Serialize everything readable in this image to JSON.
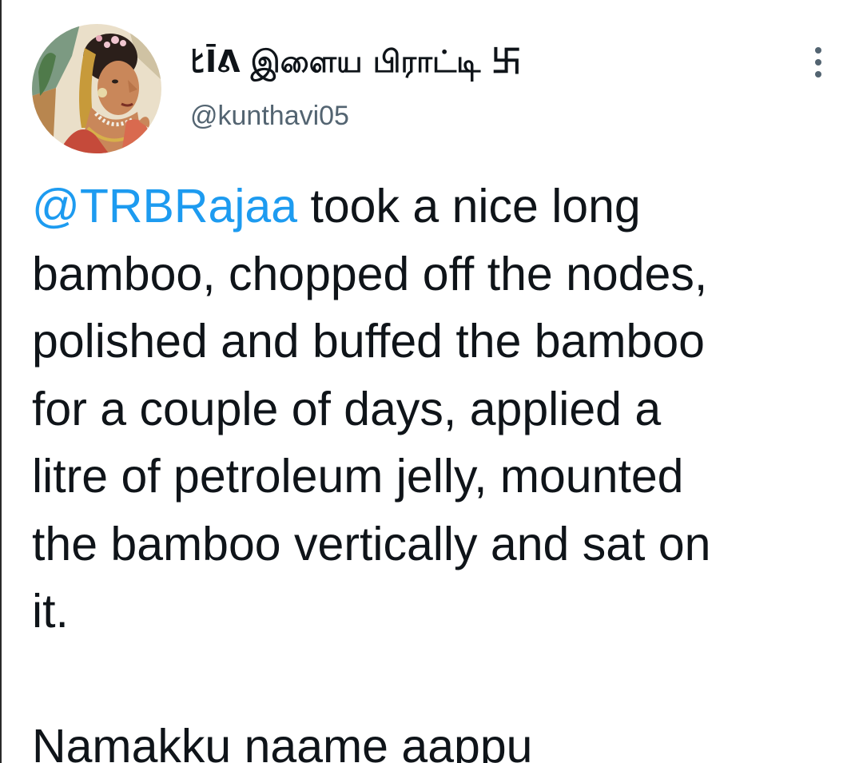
{
  "tweet": {
    "author": {
      "display_name": "ﾋĪᕕ இளைய பிராட்டி 卐",
      "handle": "@kunthavi05",
      "avatar_icon": "painted-woman-portrait-avatar"
    },
    "more_icon": "more-vertical-icon",
    "mention": "@TRBRajaa",
    "lines": [
      " took a nice long",
      "bamboo, chopped off the nodes,",
      "polished and buffed the bamboo",
      "for a couple of days, applied a",
      "litre of petroleum jelly, mounted",
      "the bamboo vertically and sat on",
      "it."
    ],
    "closing_line": "Namakku naame aappu"
  },
  "colors": {
    "mention": "#1d9bf0",
    "text": "#0f1419",
    "secondary": "#536471"
  }
}
